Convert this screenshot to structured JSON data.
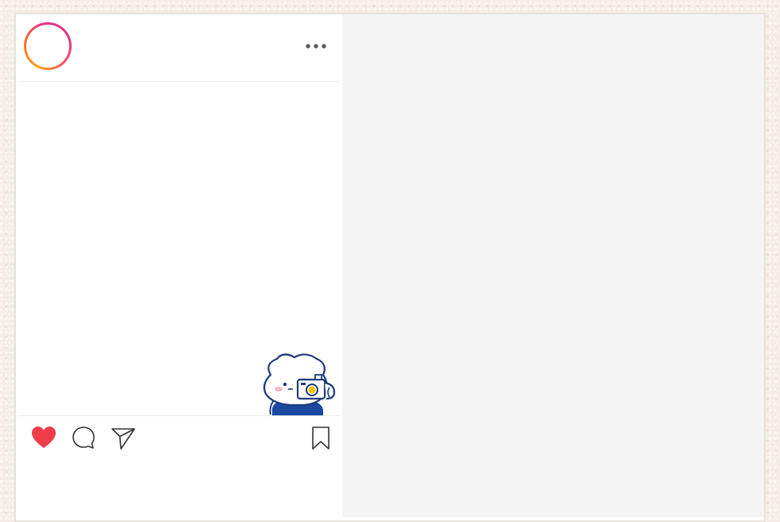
{
  "post": {
    "avatar_icon": "profile-avatar-ring",
    "more_icon": "more-options-icon",
    "image_icon": "bear-with-camera-illustration",
    "actions": {
      "like_icon": "heart-icon",
      "like_color": "#ef3e4a",
      "comment_icon": "comment-icon",
      "share_icon": "send-icon",
      "save_icon": "bookmark-icon"
    }
  },
  "colors": {
    "avatar_ring": [
      "#f7a21b",
      "#ee2f80"
    ],
    "panel": "#f4f4f4",
    "mascot_outline": "#1e3a7b",
    "camera_lens": "#f5c400"
  }
}
